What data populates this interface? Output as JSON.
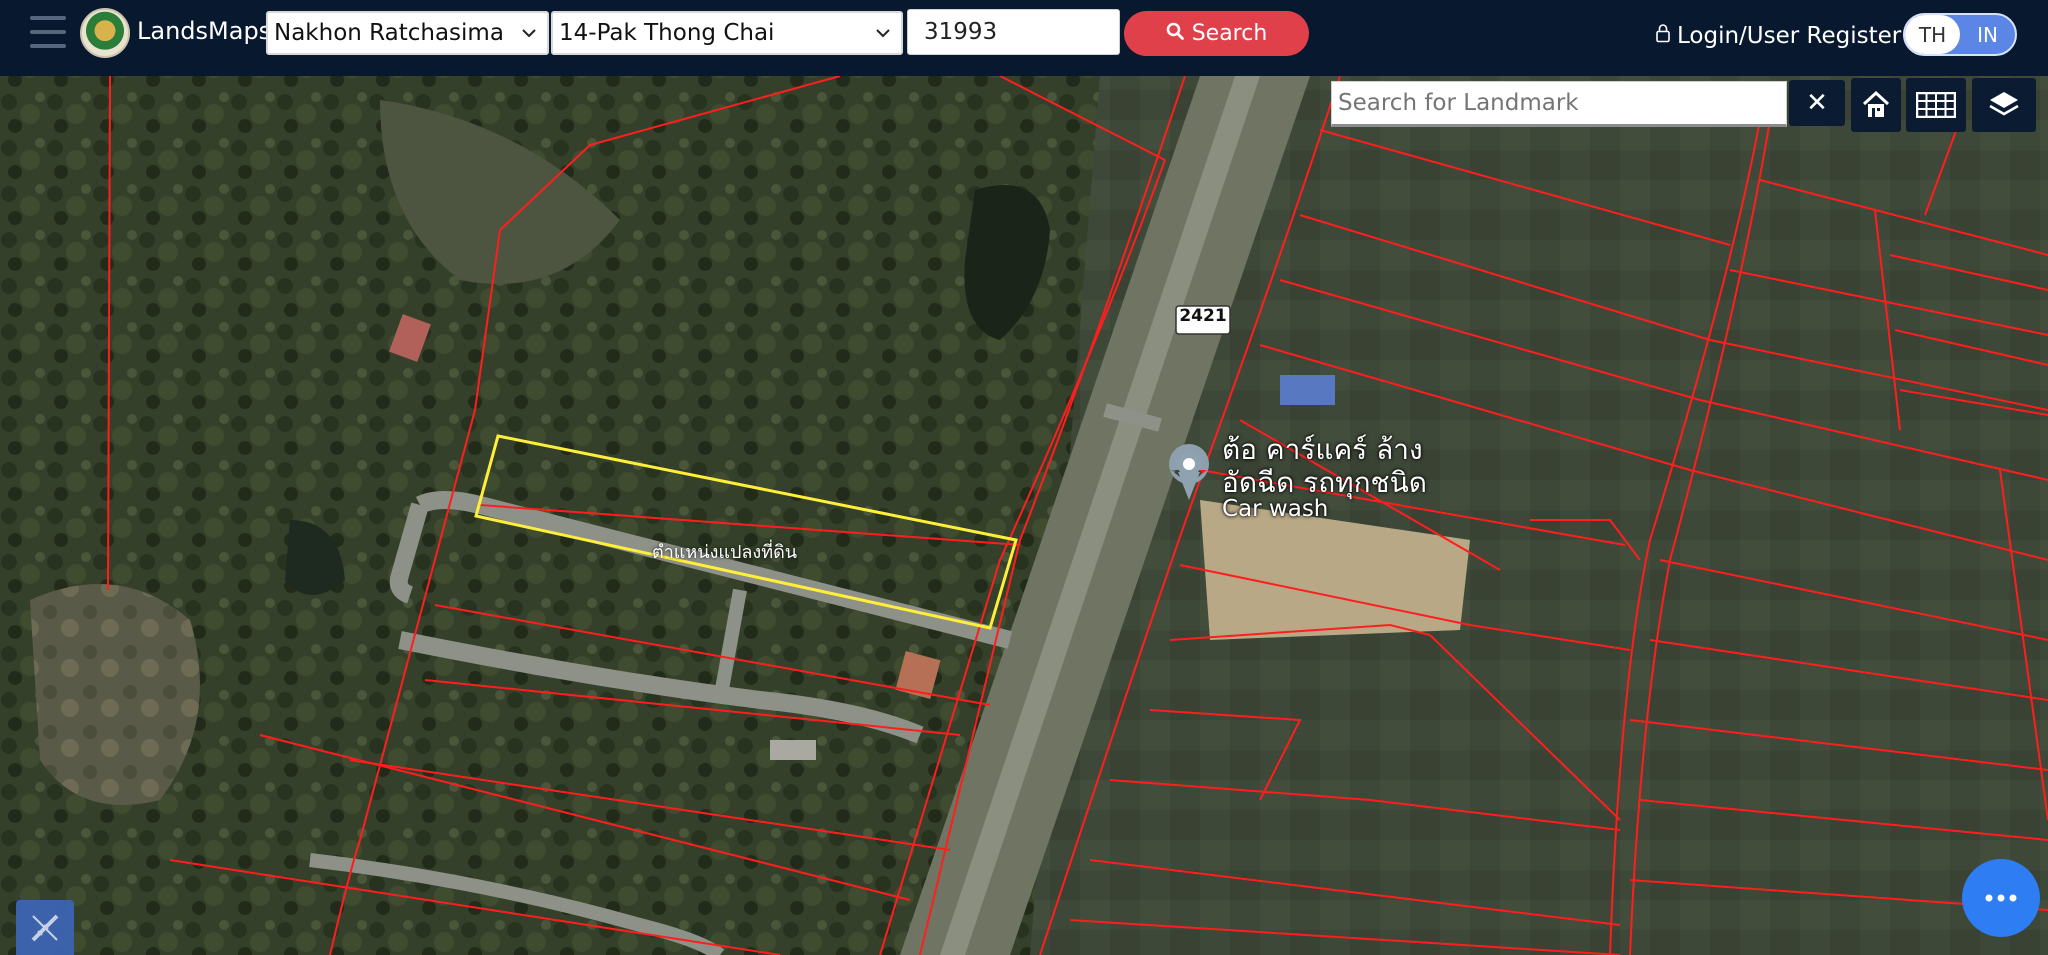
{
  "navbar": {
    "brand": "LandsMaps",
    "province": "Nakhon Ratchasima",
    "district": "14-Pak Thong Chai",
    "parcel_number": "31993",
    "search_label": "Search",
    "login_label": "Login/User Register",
    "lang_th": "TH",
    "lang_en": "IN"
  },
  "map": {
    "landmark_placeholder": "Search for Landmark",
    "road_shield": "2421",
    "parcel_label": "ตำแหน่งแปลงที่ดิน",
    "poi_name_line1": "ต้อ คาร์แคร์ ล้าง",
    "poi_name_line2": "อัดฉีด รถทุกชนิด",
    "poi_category": "Car wash",
    "clear_symbol": "✕"
  },
  "colors": {
    "navbar_bg": "#08192f",
    "search_button": "#e0404a",
    "lang_active": "#5b86e6",
    "parcel_boundary": "#ff1e1e",
    "selected_parcel": "#ffef3a",
    "chat_button": "#2f7df2"
  },
  "icons": {
    "menu": "hamburger-icon",
    "search": "magnifier-icon",
    "lock": "lock-icon",
    "home": "home-icon",
    "grid": "grid-icon",
    "layers": "layers-icon",
    "more": "ellipsis-icon",
    "measure": "ruler-icon",
    "location": "map-pin-icon"
  }
}
